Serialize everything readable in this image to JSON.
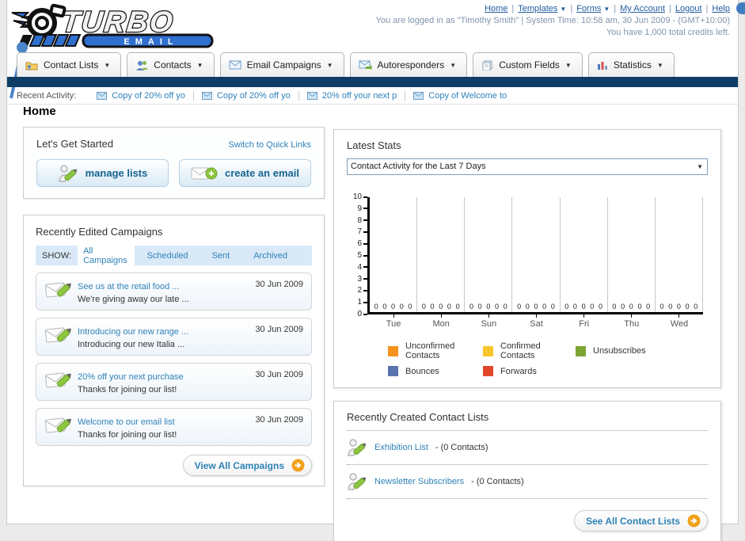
{
  "header": {
    "logo": {
      "title": "TURBO",
      "subtitle": "EMAIL"
    },
    "nav_links": [
      {
        "label": "Home",
        "dropdown": false
      },
      {
        "label": "Templates",
        "dropdown": true
      },
      {
        "label": "Forms",
        "dropdown": true
      },
      {
        "label": "My Account",
        "dropdown": false
      },
      {
        "label": "Logout",
        "dropdown": false
      },
      {
        "label": "Help",
        "dropdown": false
      }
    ],
    "login_info": "You are logged in as \"Timothy Smith\" | System Time: 10:58 am, 30 Jun 2009 - (GMT+10:00)",
    "credits_info": "You have 1,000 total credits left."
  },
  "nav_tabs": [
    {
      "label": "Contact Lists",
      "icon": "contact-lists-icon"
    },
    {
      "label": "Contacts",
      "icon": "contacts-icon"
    },
    {
      "label": "Email Campaigns",
      "icon": "email-campaigns-icon"
    },
    {
      "label": "Autoresponders",
      "icon": "autoresponders-icon"
    },
    {
      "label": "Custom Fields",
      "icon": "custom-fields-icon"
    },
    {
      "label": "Statistics",
      "icon": "statistics-icon"
    }
  ],
  "recent_activity": {
    "label": "Recent Activity:",
    "items": [
      "Copy of 20% off yo",
      "Copy of 20% off yo",
      "20% off your next p",
      "Copy of Welcome to"
    ]
  },
  "page_title": "Home",
  "get_started": {
    "title": "Let's Get Started",
    "switch_link": "Switch to Quick Links",
    "buttons": [
      {
        "label": "manage lists"
      },
      {
        "label": "create an email"
      }
    ]
  },
  "campaigns": {
    "title": "Recently Edited Campaigns",
    "show_label": "SHOW:",
    "filters": [
      "All Campaigns",
      "Scheduled",
      "Sent",
      "Archived"
    ],
    "active_filter": "All Campaigns",
    "items": [
      {
        "title": "See us at the retail food ...",
        "subtitle": "We're giving away our late ...",
        "date": "30 Jun 2009"
      },
      {
        "title": "Introducing our new range ...",
        "subtitle": "Introducing our new Italia ...",
        "date": "30 Jun 2009"
      },
      {
        "title": "20% off your next purchase",
        "subtitle": "Thanks for joining our list!",
        "date": "30 Jun 2009"
      },
      {
        "title": "Welcome to our email list",
        "subtitle": "Thanks for joining our list!",
        "date": "30 Jun 2009"
      }
    ],
    "view_all_label": "View All Campaigns"
  },
  "stats": {
    "title": "Latest Stats",
    "dropdown_value": "Contact Activity for the Last 7 Days"
  },
  "chart_data": {
    "type": "bar",
    "title": "Contact Activity for the Last 7 Days",
    "categories": [
      "Tue",
      "Mon",
      "Sun",
      "Sat",
      "Fri",
      "Thu",
      "Wed"
    ],
    "series": [
      {
        "name": "Unconfirmed Contacts",
        "color": "#f6921e",
        "values": [
          0,
          0,
          0,
          0,
          0,
          0,
          0
        ]
      },
      {
        "name": "Confirmed Contacts",
        "color": "#f9c52c",
        "values": [
          0,
          0,
          0,
          0,
          0,
          0,
          0
        ]
      },
      {
        "name": "Unsubscribes",
        "color": "#7ca533",
        "values": [
          0,
          0,
          0,
          0,
          0,
          0,
          0
        ]
      },
      {
        "name": "Bounces",
        "color": "#5873ae",
        "values": [
          0,
          0,
          0,
          0,
          0,
          0,
          0
        ]
      },
      {
        "name": "Forwards",
        "color": "#e2472a",
        "values": [
          0,
          0,
          0,
          0,
          0,
          0,
          0
        ]
      }
    ],
    "ylim": [
      0,
      10
    ],
    "ytick_step": 1,
    "grid": "vertical",
    "legend_position": "bottom",
    "data_labels_shown": true
  },
  "contact_lists": {
    "title": "Recently Created Contact Lists",
    "items": [
      {
        "name": "Exhibition List",
        "detail": "- (0 Contacts)"
      },
      {
        "name": "Newsletter Subscribers",
        "detail": "- (0 Contacts)"
      }
    ],
    "see_all_label": "See All Contact Lists"
  }
}
